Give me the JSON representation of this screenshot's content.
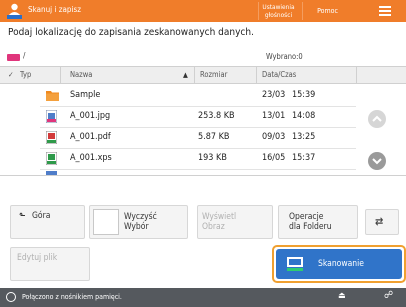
{
  "header": {
    "title": "Skanuj i zapisz",
    "settings_label": "Ustawienia głośności",
    "help_label": "Pomoc",
    "menu_icon": "hamburger-icon",
    "brand_color": "#f07d2a"
  },
  "instruction": "Podaj lokalizację do zapisania zeskanowanych danych.",
  "path": {
    "media_icon": "memory-media-icon",
    "text": "/",
    "selected": "Wybrano:0"
  },
  "table": {
    "headers": {
      "type": "Typ",
      "name": "Nazwa",
      "size": "Rozmiar",
      "datetime": "Data/Czas"
    },
    "rows": [
      {
        "icon": "folder-icon",
        "name": "Sample",
        "size": "",
        "date": "23/03",
        "time": "15:39"
      },
      {
        "icon": "jpg-file-icon",
        "name": "A_001.jpg",
        "size": "253.8 KB",
        "date": "13/01",
        "time": "14:08"
      },
      {
        "icon": "pdf-file-icon",
        "name": "A_001.pdf",
        "size": "5.87 KB",
        "date": "09/03",
        "time": "13:25"
      },
      {
        "icon": "xps-file-icon",
        "name": "A_001.xps",
        "size": "193 KB",
        "date": "16/05",
        "time": "15:37"
      }
    ]
  },
  "buttons": {
    "up": "Góra",
    "clear_line1": "Wyczyść",
    "clear_line2": "Wybór",
    "show_image_line1": "Wyświetl",
    "show_image_line2": "Obraz",
    "folder_ops_line1": "Operacje",
    "folder_ops_line2": "dla Folderu",
    "edit_file": "Edytuj plik",
    "scan": "Skanowanie"
  },
  "status": {
    "text": "Połączono z nośnikiem pamięci."
  }
}
